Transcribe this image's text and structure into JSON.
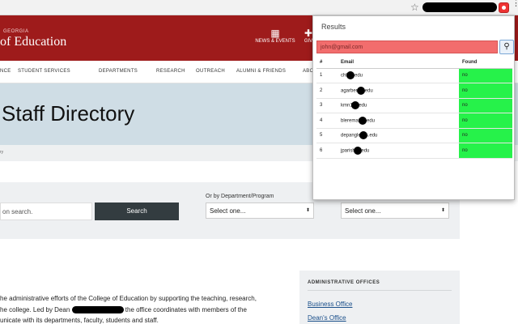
{
  "browser": {
    "star_icon": "star-icon",
    "extension_icon": "extension-icon"
  },
  "header": {
    "org_small": "GEORGIA",
    "org_big": "of Education",
    "news_label": "NEWS & EVENTS",
    "give_label": "GIV"
  },
  "nav": {
    "items": [
      "NCE",
      "STUDENT SERVICES",
      "DEPARTMENTS",
      "RESEARCH",
      "OUTREACH",
      "ALUMNI & FRIENDS",
      "ABO"
    ]
  },
  "page": {
    "title": "Staff Directory",
    "breadcrumb": "ry"
  },
  "search": {
    "input_text": "on search.",
    "button_label": "Search",
    "dept_label": "Or by Department/Program",
    "select1_value": "Select one...",
    "select2_value": "Select one..."
  },
  "intro": {
    "line1": "he administrative efforts of the College of Education by supporting the teaching, research,",
    "line2a": "he college. Led by Dean",
    "line2b": "the office coordinates with members of the",
    "line3": "unicate with its departments, faculty, students and staff."
  },
  "admin": {
    "heading": "ADMINISTRATIVE OFFICES",
    "links": [
      "Business Office",
      "Dean's Office"
    ]
  },
  "popup": {
    "title": "Results",
    "email_value": "john@gmail.com",
    "search_icon": "magnifier-icon",
    "columns": [
      "#",
      "Email",
      "Found"
    ],
    "rows": [
      {
        "num": "1",
        "email_a": "chk",
        "email_b": ".edu",
        "found": "no"
      },
      {
        "num": "2",
        "email_a": "agarben",
        "email_b": ".edu",
        "found": "no"
      },
      {
        "num": "3",
        "email_a": "kmn1",
        "email_b": ".edu",
        "found": "no"
      },
      {
        "num": "4",
        "email_a": "bleremail",
        "email_b": ".edu",
        "found": "no"
      },
      {
        "num": "5",
        "email_a": "depangle",
        "email_b": "s.edu",
        "found": "no"
      },
      {
        "num": "6",
        "email_a": "jparish",
        "email_b": ".edu",
        "found": "no"
      }
    ],
    "found_color": "#26f24a",
    "input_color": "#f26d6d"
  }
}
